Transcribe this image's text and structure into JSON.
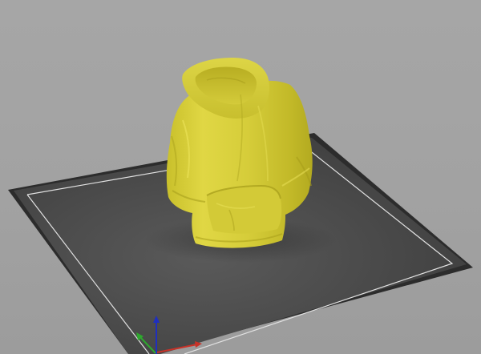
{
  "viewport": {
    "background_color": "#a4a4a4"
  },
  "build_plate": {
    "edge_color": "#2c2c2c",
    "surface_color": "#4a4a4a",
    "border_line_color": "#e2e2e2"
  },
  "model": {
    "object": "hoodie",
    "color": "#d8cf3a"
  },
  "axes_gizmo": {
    "icon": "xyz-axes-icon",
    "x_color": "#c83228",
    "y_color": "#2ea82e",
    "z_color": "#1f2fbf"
  }
}
